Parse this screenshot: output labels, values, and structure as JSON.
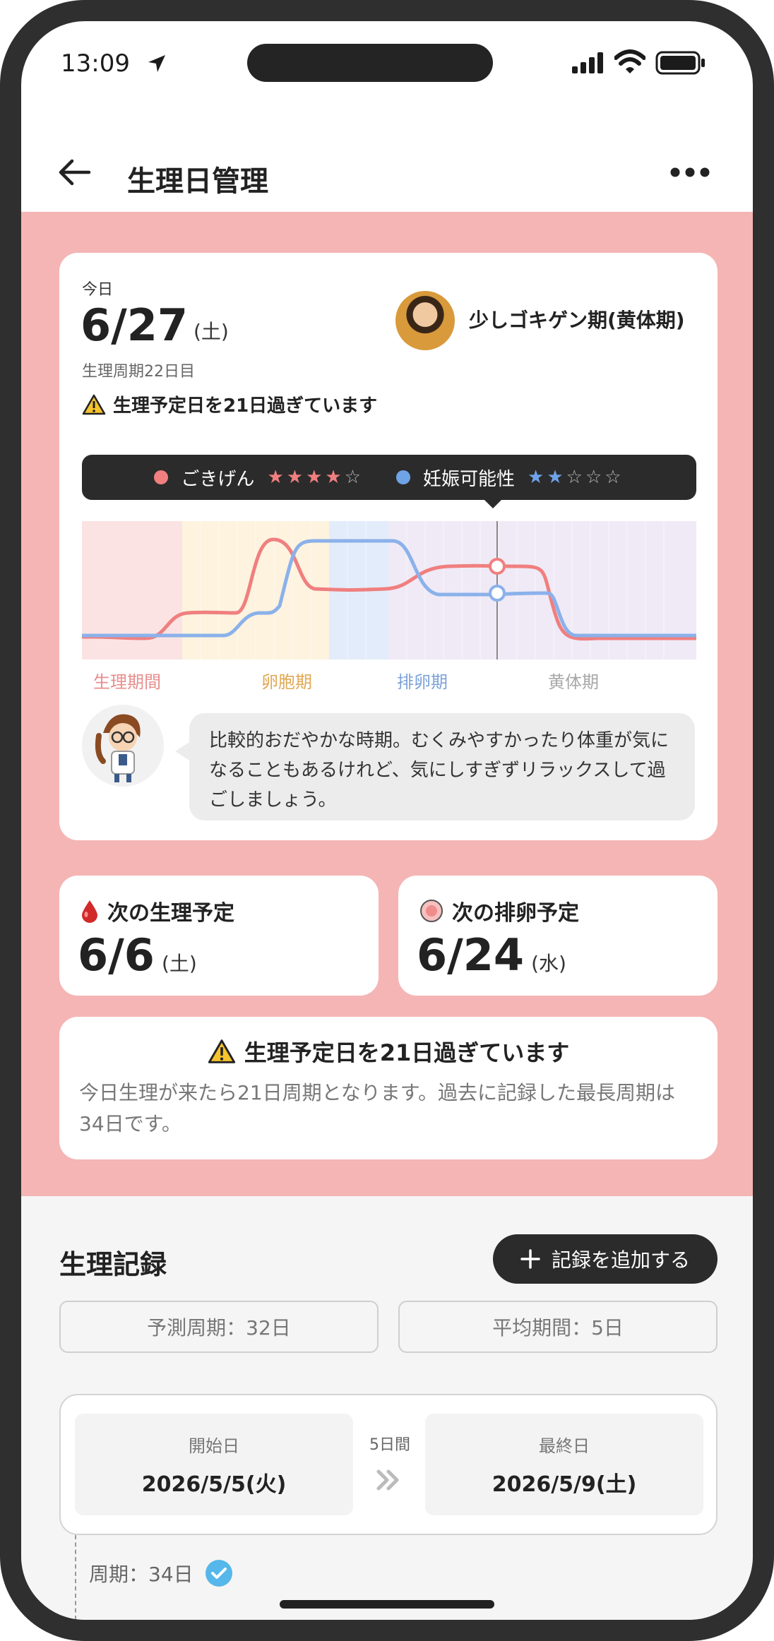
{
  "status": {
    "time": "13:09"
  },
  "header": {
    "title": "生理日管理"
  },
  "today": {
    "label": "今日",
    "date": "6/27",
    "dow": "(土)",
    "cycle_day": "生理周期22日目",
    "phase": "少しゴキゲン期(黄体期)",
    "warning": "生理予定日を21日過ぎています"
  },
  "legend": {
    "mood_label": "ごきげん",
    "mood_stars": 4,
    "fertility_label": "妊娠可能性",
    "fertility_stars": 2,
    "max_stars": 5,
    "mood_color": "#f07f7f",
    "fertility_color": "#6fa3e8"
  },
  "phases": [
    {
      "label": "生理期間",
      "color": "#e98e8e"
    },
    {
      "label": "卵胞期",
      "color": "#e0a955"
    },
    {
      "label": "排卵期",
      "color": "#7ea3d9"
    },
    {
      "label": "黄体期",
      "color": "#a8a8a8"
    }
  ],
  "advice": "比較的おだやかな時期。むくみやすかったり体重が気になることもあるけれど、気にしすぎずリラックスして過ごしましょう。",
  "next_period": {
    "title": "次の生理予定",
    "date": "6/6",
    "dow": "(土)"
  },
  "next_ovulation": {
    "title": "次の排卵予定",
    "date": "6/24",
    "dow": "(水)"
  },
  "alert": {
    "title": "生理予定日を21日過ぎています",
    "body": "今日生理が来たら21日周期となります。過去に記録した最長周期は34日です。"
  },
  "records": {
    "title": "生理記録",
    "add_label": "記録を追加する",
    "predicted_cycle": "予測周期：32日",
    "average_period": "平均期間：5日",
    "entry": {
      "start_label": "開始日",
      "start_date": "2026/5/5(火)",
      "duration": "5日間",
      "end_label": "最終日",
      "end_date": "2026/5/9(土)"
    },
    "cycle": "周期：34日"
  }
}
